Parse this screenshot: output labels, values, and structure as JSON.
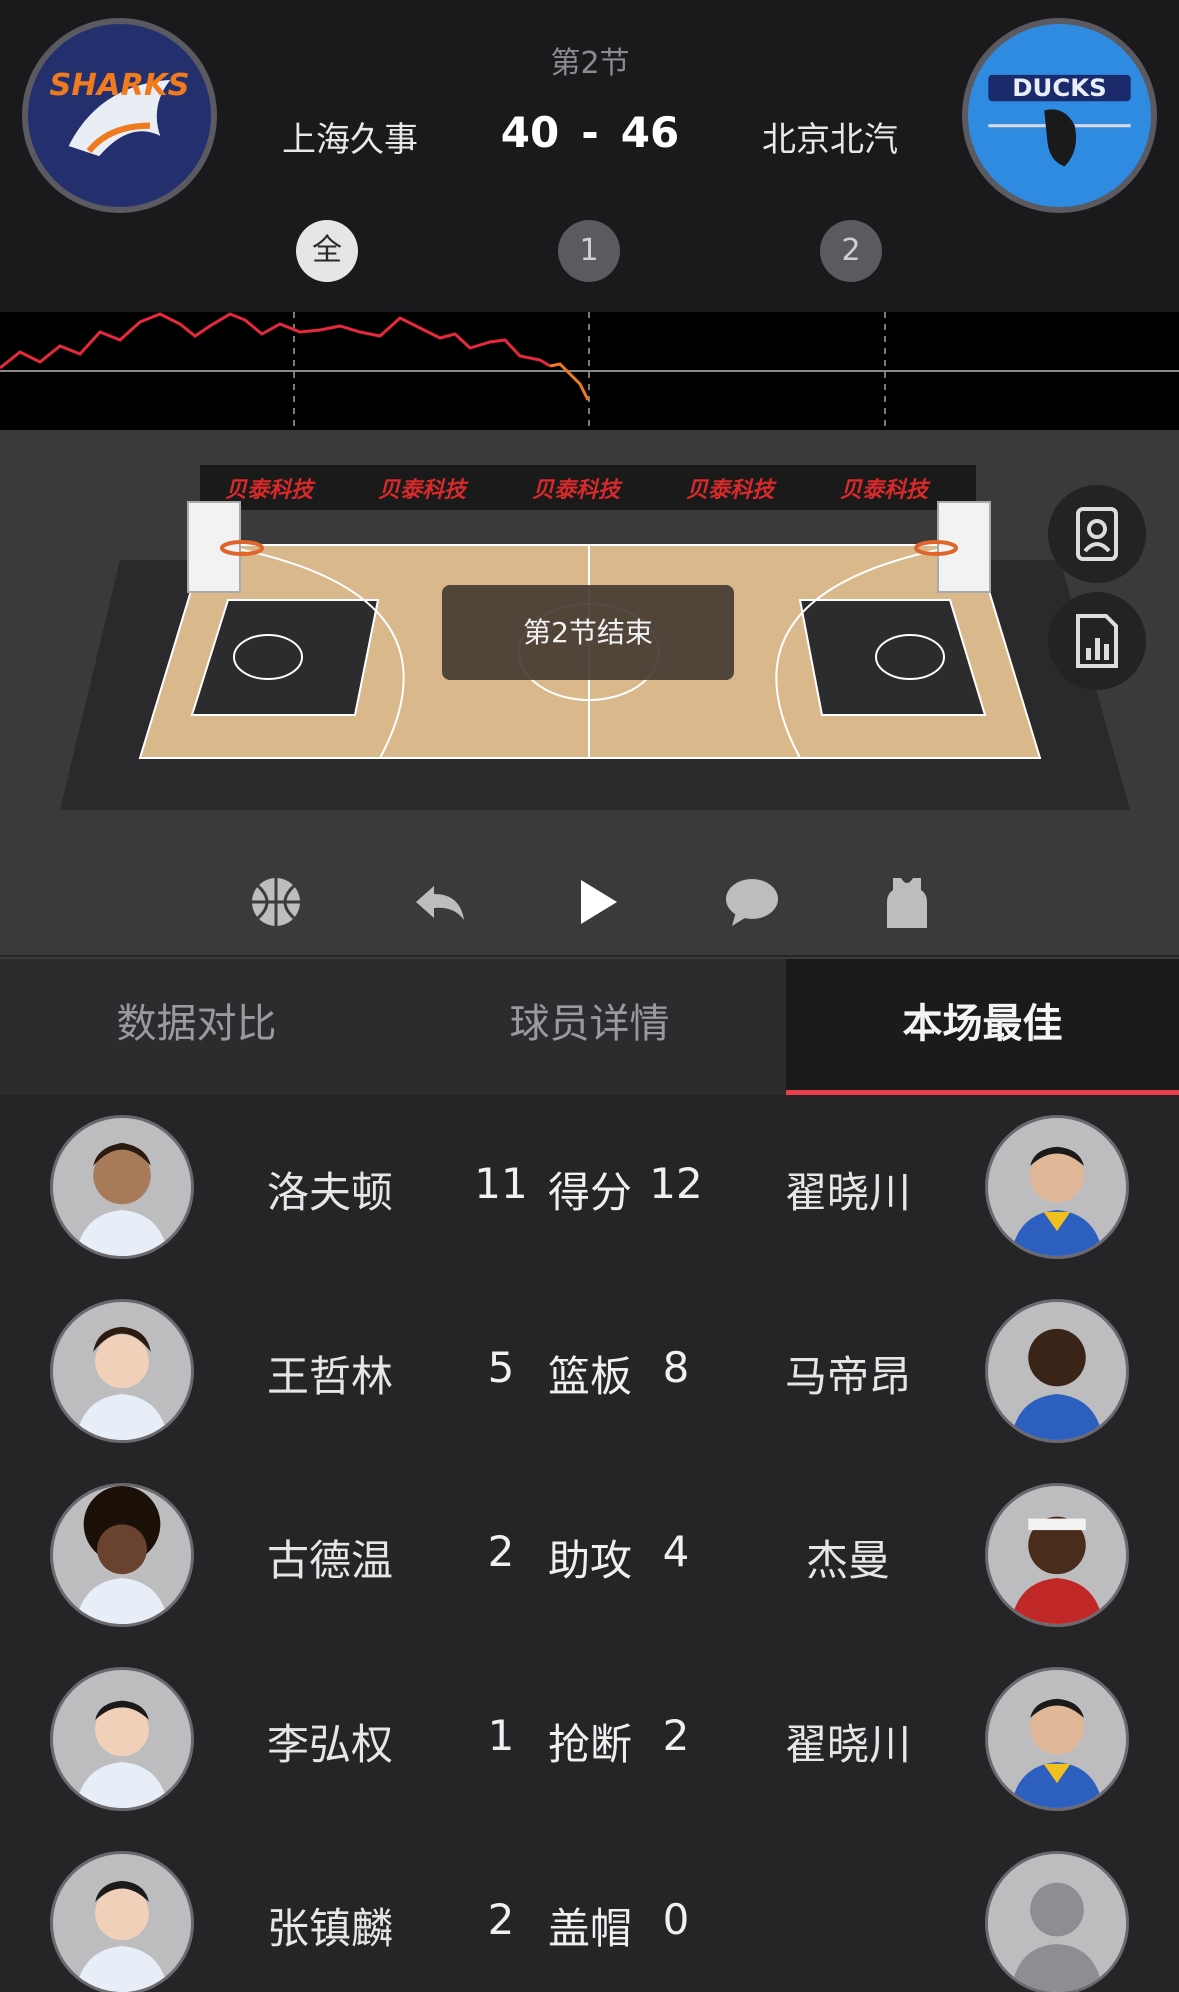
{
  "header": {
    "period_title": "第2节",
    "home": {
      "name": "上海久事",
      "score": "40",
      "logo": "sharks-logo",
      "logo_text": "SHARKS"
    },
    "away": {
      "name": "北京北汽",
      "score": "46",
      "logo": "ducks-logo",
      "logo_text": "DUCKS"
    },
    "score_separator": "-",
    "periods": [
      {
        "label": "全",
        "active": true
      },
      {
        "label": "1",
        "active": false
      },
      {
        "label": "2",
        "active": false
      }
    ]
  },
  "court": {
    "status_text": "第2节结束",
    "sponsor_text": "贝泰科技",
    "side_buttons": [
      "roster-icon",
      "stats-chart-icon"
    ]
  },
  "controls": [
    "basketball-icon",
    "replay-icon",
    "play-icon",
    "comment-icon",
    "jersey-icon"
  ],
  "tabs": [
    {
      "label": "数据对比",
      "active": false
    },
    {
      "label": "球员详情",
      "active": false
    },
    {
      "label": "本场最佳",
      "active": true
    }
  ],
  "leaders": [
    {
      "stat": "得分",
      "home_player": "洛夫顿",
      "home_value": "11",
      "away_player": "翟晓川",
      "away_value": "12"
    },
    {
      "stat": "篮板",
      "home_player": "王哲林",
      "home_value": "5",
      "away_player": "马帝昂",
      "away_value": "8"
    },
    {
      "stat": "助攻",
      "home_player": "古德温",
      "home_value": "2",
      "away_player": "杰曼",
      "away_value": "4"
    },
    {
      "stat": "抢断",
      "home_player": "李弘权",
      "home_value": "1",
      "away_player": "翟晓川",
      "away_value": "2"
    },
    {
      "stat": "盖帽",
      "home_player": "张镇麟",
      "home_value": "2",
      "away_player": "",
      "away_value": "0"
    }
  ],
  "colors": {
    "accent": "#e8404a",
    "trend_home": "#e8283c",
    "trend_away": "#f07a1e",
    "court_wood": "#d9b88c"
  }
}
